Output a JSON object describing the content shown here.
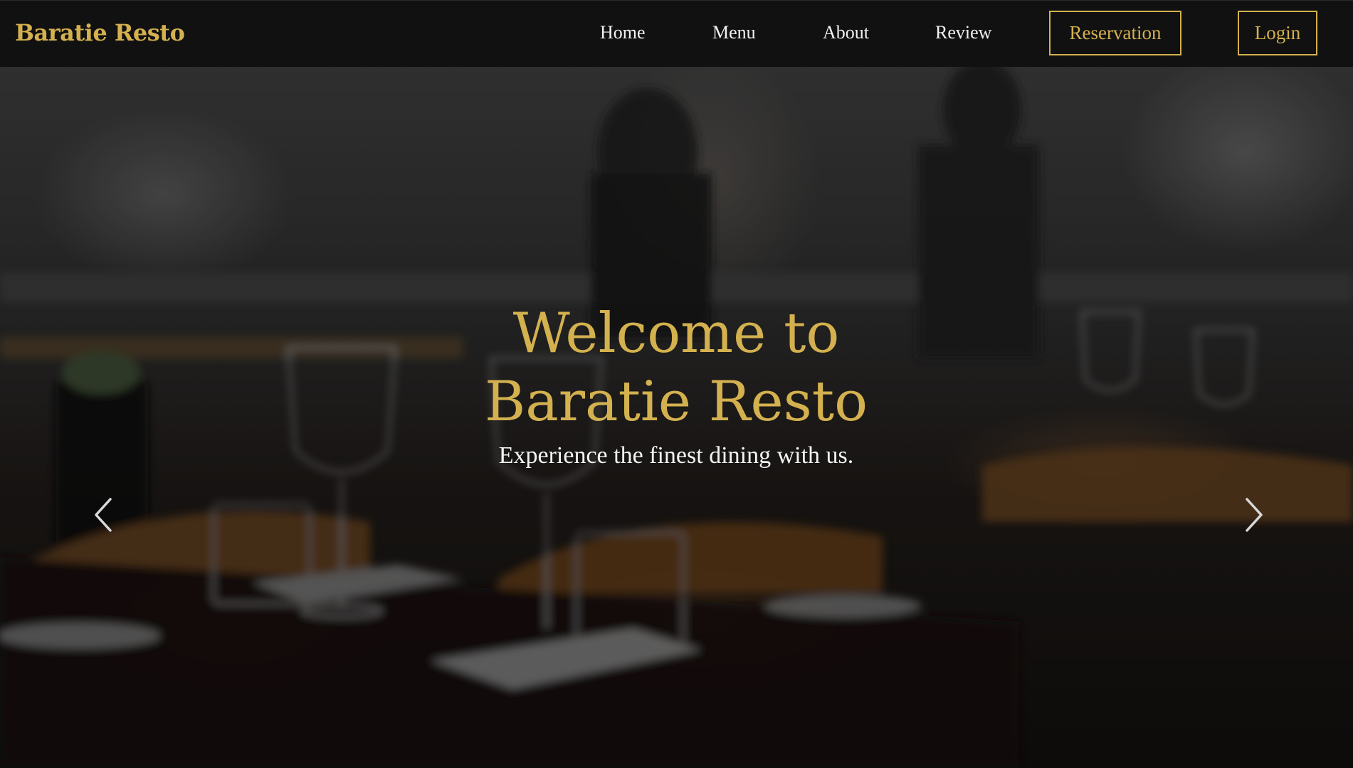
{
  "nav": {
    "brand": "Baratie Resto",
    "links": [
      "Home",
      "Menu",
      "About",
      "Review"
    ],
    "reservation_label": "Reservation",
    "login_label": "Login"
  },
  "hero": {
    "title_line1": "Welcome to",
    "title_line2": "Baratie Resto",
    "subtitle": "Experience the finest dining with us.",
    "prev_icon": "chevron-left-icon",
    "next_icon": "chevron-right-icon"
  },
  "colors": {
    "accent": "#d4b14f",
    "navbar_bg": "#111111",
    "text": "#f2f2f2"
  }
}
